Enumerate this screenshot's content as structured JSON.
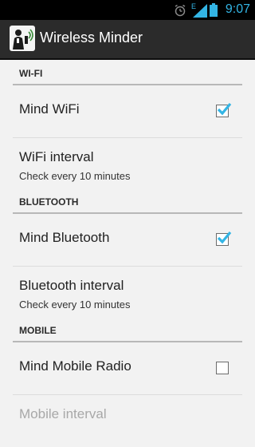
{
  "status_bar": {
    "time": "9:07",
    "network_type": "E",
    "icons": [
      "alarm-icon",
      "signal-icon",
      "battery-icon"
    ],
    "accent_color": "#33b5e5"
  },
  "action_bar": {
    "title": "Wireless Minder",
    "icon": "app-icon"
  },
  "sections": {
    "wifi": {
      "header": "WI-FI",
      "toggle": {
        "label": "Mind WiFi",
        "checked": true
      },
      "interval": {
        "label": "WiFi interval",
        "summary": "Check every 10 minutes"
      }
    },
    "bluetooth": {
      "header": "BLUETOOTH",
      "toggle": {
        "label": "Mind Bluetooth",
        "checked": true
      },
      "interval": {
        "label": "Bluetooth interval",
        "summary": "Check every 10 minutes"
      }
    },
    "mobile": {
      "header": "MOBILE",
      "toggle": {
        "label": "Mind Mobile Radio",
        "checked": false
      },
      "interval": {
        "label": "Mobile interval",
        "summary": ""
      }
    }
  },
  "colors": {
    "check_color": "#33b5e5",
    "action_bar_bg": "#2b2b2b",
    "list_bg": "#f2f2f2"
  }
}
